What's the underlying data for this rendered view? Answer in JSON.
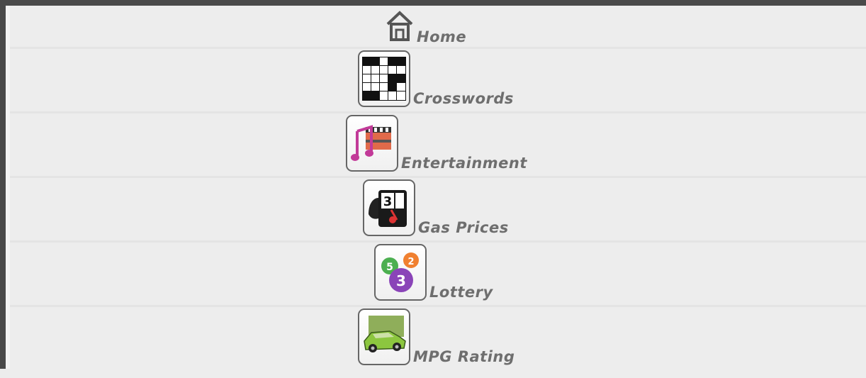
{
  "menu": {
    "items": [
      {
        "label": "Home",
        "icon": "home-icon"
      },
      {
        "label": "Crosswords",
        "icon": "crossword-icon"
      },
      {
        "label": "Entertainment",
        "icon": "entertainment-icon"
      },
      {
        "label": "Gas Prices",
        "icon": "gas-prices-icon"
      },
      {
        "label": "Lottery",
        "icon": "lottery-icon"
      },
      {
        "label": "MPG Rating",
        "icon": "mpg-rating-icon"
      }
    ]
  },
  "colors": {
    "label": "#6e6e6e",
    "frame": "#4a4a4a",
    "background": "#ececec"
  }
}
